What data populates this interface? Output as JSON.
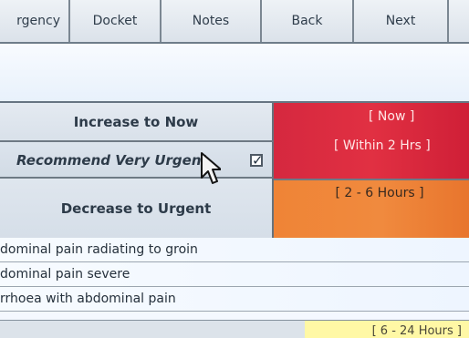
{
  "tabs": [
    {
      "label": "rgency",
      "name": "tab-urgency"
    },
    {
      "label": "Docket",
      "name": "tab-docket"
    },
    {
      "label": "Notes",
      "name": "tab-notes"
    },
    {
      "label": "Back",
      "name": "tab-back"
    },
    {
      "label": "Next",
      "name": "tab-next"
    }
  ],
  "urgency": {
    "increase_label": "Increase to Now",
    "recommend_label": "Recommend Very Urgent",
    "checkbox_mark": "✓",
    "decrease_label": "Decrease to Urgent",
    "now_label": "[ Now ]",
    "within_label": "[ Within 2 Hrs ]",
    "hours_label": "[ 2 - 6 Hours ]",
    "colors": {
      "very_urgent": "#dc2d40",
      "urgent": "#f08a3e",
      "less_urgent": "#fff8a5"
    }
  },
  "complaints": [
    "dominal pain radiating to groin",
    "dominal pain severe",
    "rrhoea with abdominal pain"
  ],
  "footer": {
    "partial_label": "[ 6 - 24 Hours ]"
  },
  "icons": {
    "cursor": "mouse-pointer-icon",
    "checkbox": "checkmark-icon"
  }
}
